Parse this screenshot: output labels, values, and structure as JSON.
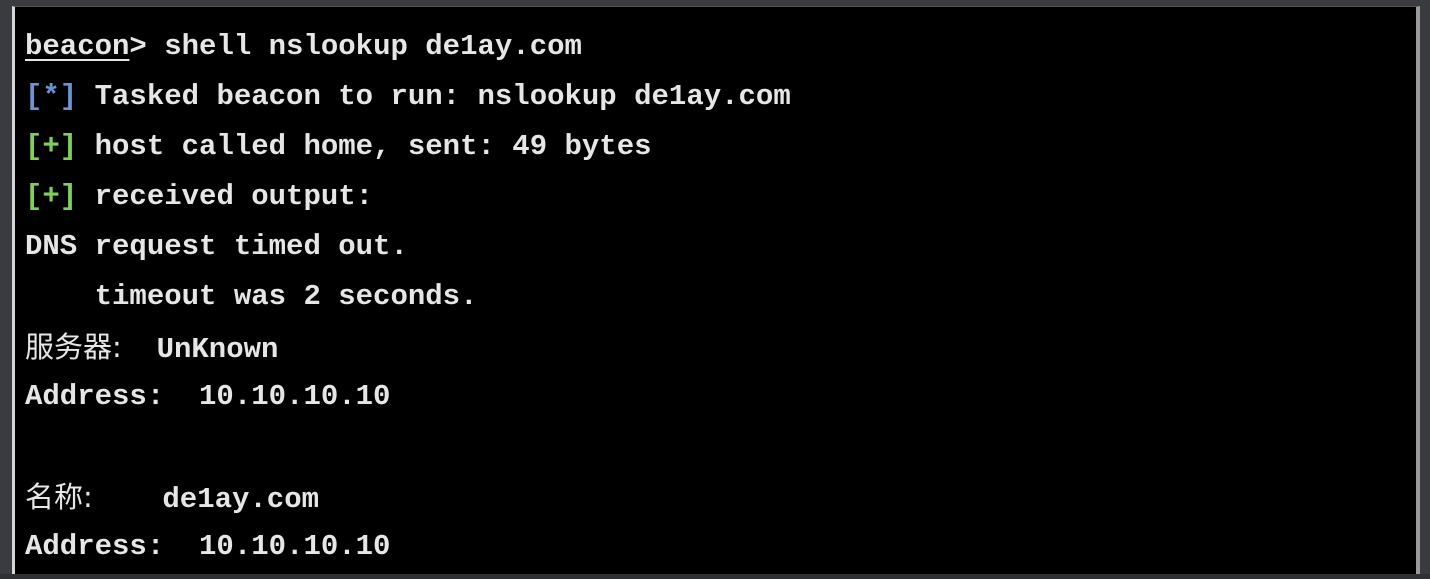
{
  "lines": [
    {
      "prompt": "beacon",
      "gt": ">",
      "text": " shell nslookup de1ay.com"
    },
    {
      "marker": "[*]",
      "text": " Tasked beacon to run: nslookup de1ay.com"
    },
    {
      "marker": "[+]",
      "text": " host called home, sent: 49 bytes"
    },
    {
      "marker": "[+]",
      "text": " received output:"
    },
    {
      "text": "DNS request timed out."
    },
    {
      "text": "    timeout was 2 seconds."
    },
    {
      "label": "服务器:",
      "text": "  UnKnown"
    },
    {
      "text": "Address:  10.10.10.10"
    },
    {
      "text": ""
    },
    {
      "label": "名称:",
      "text": "    de1ay.com"
    },
    {
      "text": "Address:  10.10.10.10"
    }
  ],
  "colors": {
    "background": "#000000",
    "text": "#e6e6e6",
    "info_marker": "#6a94d4",
    "success_marker": "#7fd05a"
  }
}
